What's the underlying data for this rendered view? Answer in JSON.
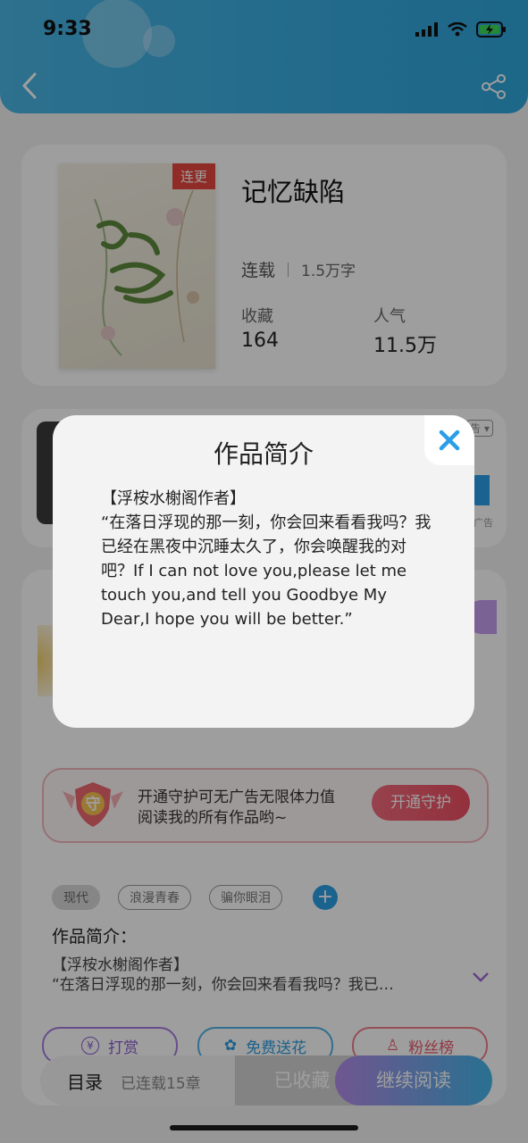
{
  "status_bar": {
    "time": "9:33"
  },
  "book": {
    "title": "记忆缺陷",
    "cover_badge": "连更",
    "status": "连载",
    "word_count": "1.5万字",
    "favorites_label": "收藏",
    "favorites_value": "164",
    "popularity_label": "人气",
    "popularity_value": "11.5万"
  },
  "ad": {
    "corner_label": "告",
    "small_label": "广告"
  },
  "guard": {
    "badge_text": "守",
    "text_line1": "开通守护可无广告无限体力值",
    "text_line2": "阅读我的所有作品哟~",
    "button_label": "开通守护"
  },
  "tags": [
    "现代",
    "浪漫青春",
    "骗你眼泪"
  ],
  "intro": {
    "heading": "作品简介：",
    "line1": "【浮桉水榭阁作者】",
    "line2": "“在落日浮现的那一刻，你会回来看看我吗？我已…"
  },
  "actions": {
    "reward_label": "打赏",
    "reward_icon_text": "¥",
    "flower_label": "免费送花",
    "fans_label": "粉丝榜"
  },
  "bottom_bar": {
    "catalog_label": "目录",
    "chapters_label": "已连载15章",
    "favorited_label": "已收藏",
    "continue_label": "继续阅读"
  },
  "modal": {
    "title": "作品简介",
    "body": "【浮桉水榭阁作者】\n“在落日浮现的那一刻，你会回来看看我吗？我已经在黑夜中沉睡太久了，你会唤醒我的对吧？If I can not love you,please let me touch you,and tell you Goodbye My Dear,I hope you will be better.”"
  },
  "colors": {
    "header": "#3aaee0",
    "accent_pink": "#e8473f",
    "close_blue": "#2a9ee8"
  }
}
